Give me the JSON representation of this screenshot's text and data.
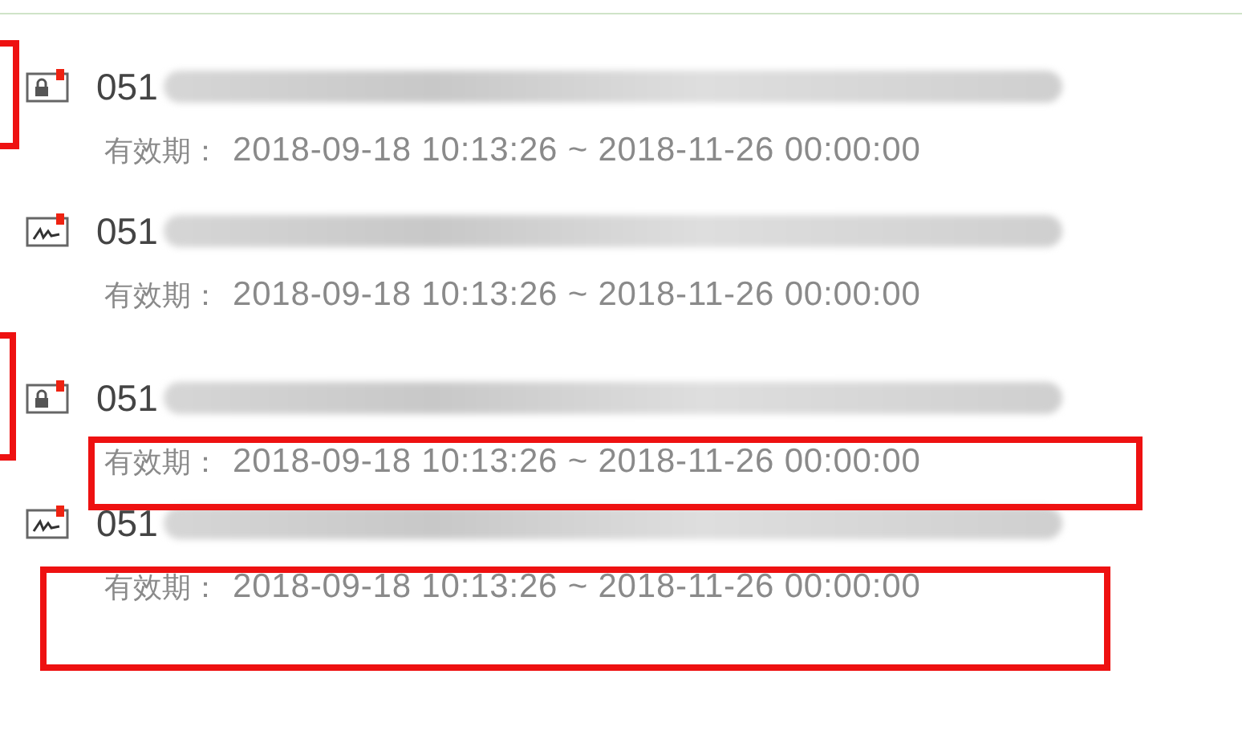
{
  "certificates": [
    {
      "kind": "lock",
      "title": "051",
      "validity_label": "有效期：",
      "validity": "2018-09-18 10:13:26 ~ 2018-11-26 00:00:00"
    },
    {
      "kind": "signature",
      "title": "051",
      "validity_label": "有效期：",
      "validity": "2018-09-18 10:13:26 ~ 2018-11-26 00:00:00"
    },
    {
      "kind": "lock",
      "title": "051",
      "validity_label": "有效期：",
      "validity": "2018-09-18 10:13:26 ~ 2018-11-26 00:00:00"
    },
    {
      "kind": "signature",
      "title": "051",
      "validity_label": "有效期：",
      "validity": "2018-09-18 10:13:26 ~ 2018-11-26 00:00:00"
    }
  ]
}
